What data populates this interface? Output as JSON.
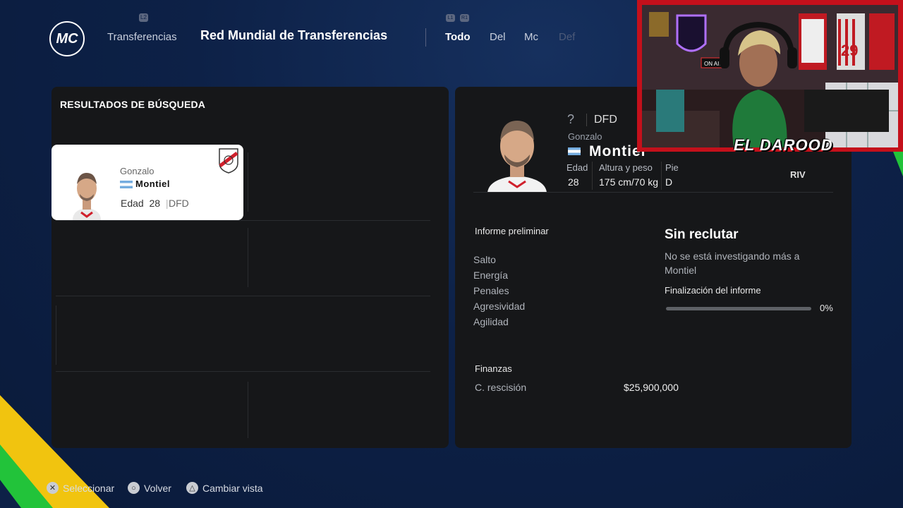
{
  "header": {
    "logo_text": "MC",
    "breadcrumb": "Transferencias",
    "breadcrumb_badge": "L2",
    "title": "Red Mundial de Transferencias",
    "tabs": [
      {
        "label": "Todo",
        "state": "active"
      },
      {
        "label": "Del",
        "state": "normal"
      },
      {
        "label": "Mc",
        "state": "normal"
      },
      {
        "label": "Def",
        "state": "disabled"
      }
    ],
    "bumper_left": "L1",
    "bumper_right": "R1"
  },
  "results": {
    "title": "RESULTADOS DE BÚSQUEDA",
    "card": {
      "first_name": "Gonzalo",
      "last_name": "Montiel",
      "age_label": "Edad",
      "age": "28",
      "position": "DFD",
      "nationality": "argentina-flag",
      "club": "river-plate-crest"
    }
  },
  "detail": {
    "overall": "?",
    "position": "DFD",
    "first_name": "Gonzalo",
    "last_name": "Montiel",
    "club_short": "RIV",
    "stats": [
      {
        "label": "Edad",
        "value": "28"
      },
      {
        "label": "Altura y peso",
        "value": "175 cm/70 kg"
      },
      {
        "label": "Pie",
        "value": "D"
      }
    ],
    "report_title": "Informe preliminar",
    "attributes": [
      "Salto",
      "Energía",
      "Penales",
      "Agresividad",
      "Agilidad"
    ],
    "scout_status": "Sin reclutar",
    "scout_desc": "No se está investigando más a Montiel",
    "progress_label": "Finalización del informe",
    "progress_value": "0%",
    "progress_fraction": 0,
    "finance_title": "Finanzas",
    "finance_label": "C. rescisión",
    "finance_value": "$25,900,000"
  },
  "webcam": {
    "overlay_text": "EL DAROOD",
    "jersey_number": "29",
    "sign_text": "ON AIR"
  },
  "footer": {
    "hints": [
      {
        "icon": "cross-button-icon",
        "label": "Seleccionar"
      },
      {
        "icon": "circle-button-icon",
        "label": "Volver"
      },
      {
        "icon": "triangle-button-icon",
        "label": "Cambiar vista"
      }
    ]
  },
  "colors": {
    "background": "#0d2147",
    "panel": "#161719",
    "webcam_frame": "#c4101b",
    "deco_yellow": "#f1c40f",
    "deco_green": "#22c33a"
  }
}
